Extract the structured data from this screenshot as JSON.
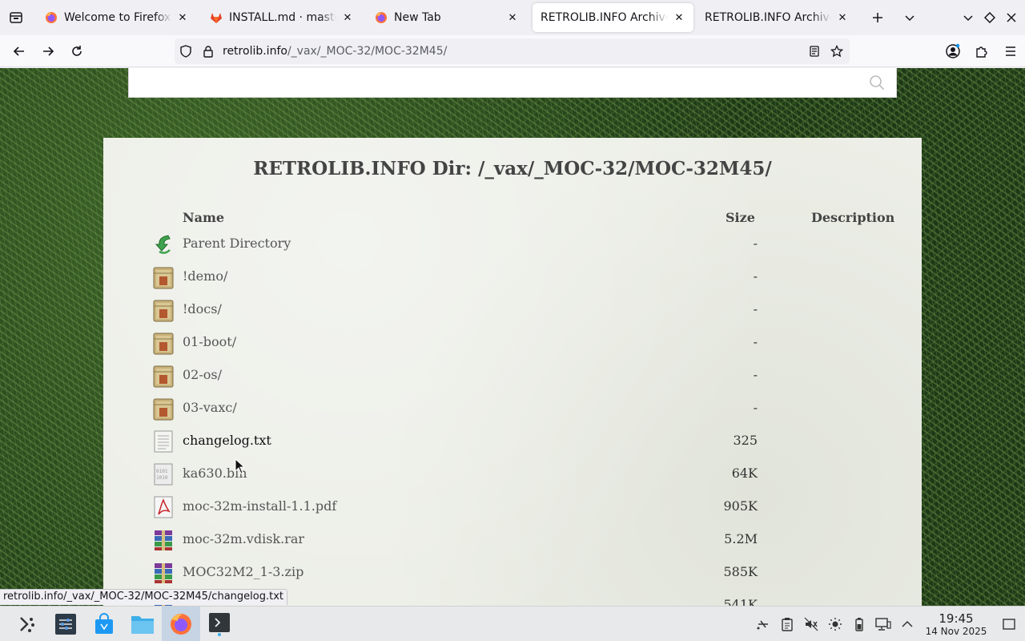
{
  "tabs": [
    {
      "label": "Welcome to Firefox",
      "icon": "firefox-icon",
      "active": false
    },
    {
      "label": "INSTALL.md · master · v",
      "icon": "gitlab-icon",
      "active": false
    },
    {
      "label": "New Tab",
      "icon": "firefox-icon",
      "active": false
    },
    {
      "label": "RETROLIB.INFO Archive MA",
      "icon": "none",
      "active": true
    },
    {
      "label": "RETROLIB.INFO Archive MA",
      "icon": "none",
      "active": false
    }
  ],
  "url": {
    "host": "retrolib.info",
    "path": "/_vax/_MOC-32/MOC-32M45/"
  },
  "page": {
    "title": "RETROLIB.INFO Dir: /_vax/_MOC-32/MOC-32M45/",
    "headers": {
      "name": "Name",
      "size": "Size",
      "description": "Description"
    },
    "rows": [
      {
        "name": "Parent Directory",
        "size": "-",
        "icon": "parent-dir-icon"
      },
      {
        "name": "!demo/",
        "size": "-",
        "icon": "folder-icon"
      },
      {
        "name": "!docs/",
        "size": "-",
        "icon": "folder-icon"
      },
      {
        "name": "01-boot/",
        "size": "-",
        "icon": "folder-icon"
      },
      {
        "name": "02-os/",
        "size": "-",
        "icon": "folder-icon"
      },
      {
        "name": "03-vaxc/",
        "size": "-",
        "icon": "folder-icon"
      },
      {
        "name": "changelog.txt",
        "size": "325",
        "icon": "text-file-icon"
      },
      {
        "name": "ka630.bin",
        "size": "64K",
        "icon": "binary-file-icon"
      },
      {
        "name": "moc-32m-install-1.1.pdf",
        "size": "905K",
        "icon": "pdf-file-icon"
      },
      {
        "name": "moc-32m.vdisk.rar",
        "size": "5.2M",
        "icon": "archive-icon"
      },
      {
        "name": "MOC32M2_1-3.zip",
        "size": "585K",
        "icon": "archive-icon"
      },
      {
        "name": "",
        "size": "541K",
        "icon": "archive-icon"
      }
    ]
  },
  "status_url": "retrolib.info/_vax/_MOC-32/MOC-32M45/changelog.txt",
  "clock": {
    "time": "19:45",
    "date": "14 Nov 2025"
  },
  "colors": {
    "accent": "#0060df",
    "panel": "#eceee7"
  }
}
